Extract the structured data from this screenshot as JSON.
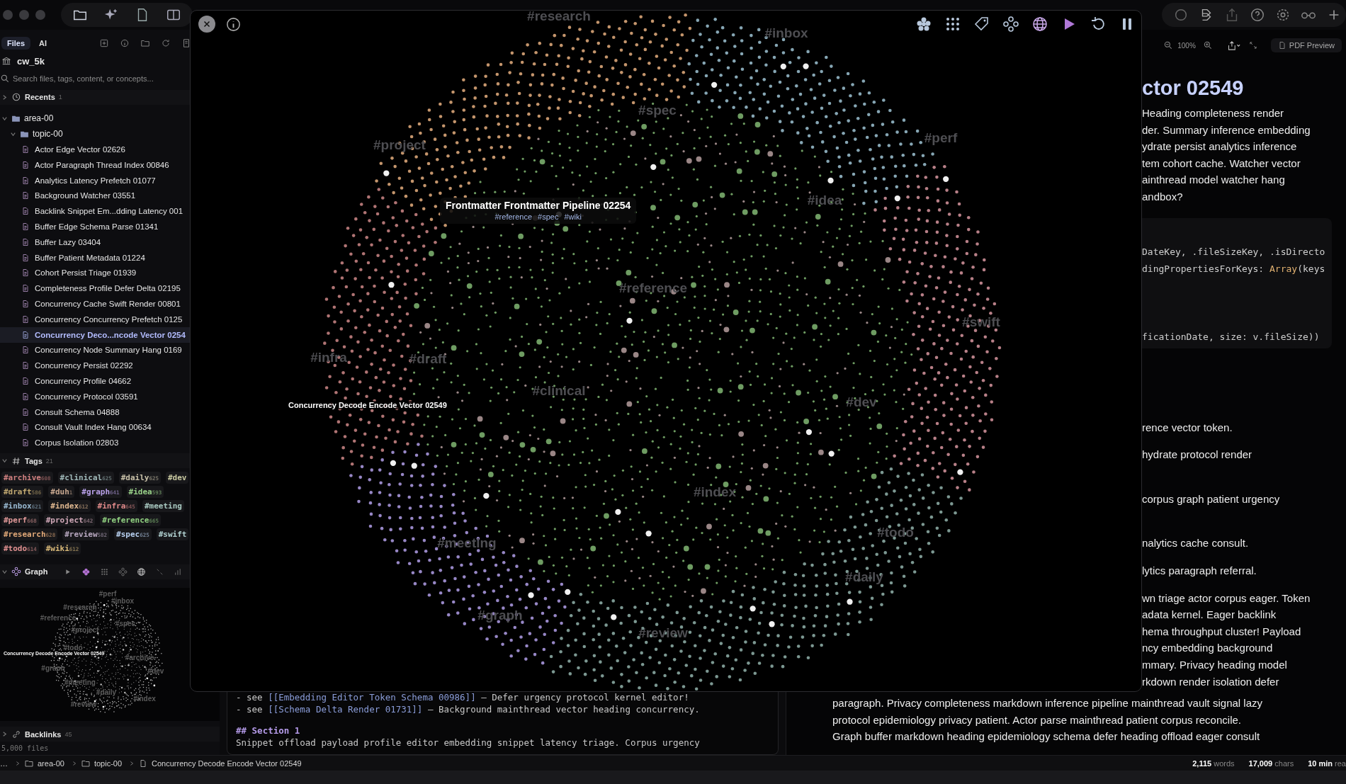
{
  "sidebar": {
    "tabs": [
      {
        "label": "Files",
        "selected": true
      },
      {
        "label": "AI",
        "selected": false
      }
    ],
    "vault": "cw_5k",
    "search": {
      "placeholder": "Search files, tags, content, or concepts..."
    },
    "recents": {
      "label": "Recents",
      "count": "1",
      "expanded": false
    },
    "tree": [
      {
        "label": "area-00",
        "expanded": true,
        "children": [
          {
            "label": "topic-00",
            "expanded": true,
            "children": [
              {
                "label": "Actor Edge Vector 02626",
                "selected": false
              },
              {
                "label": "Actor Paragraph Thread Index 00846",
                "selected": false
              },
              {
                "label": "Analytics Latency Prefetch 01077",
                "selected": false
              },
              {
                "label": "Background Watcher 03551",
                "selected": false
              },
              {
                "label": "Backlink Snippet Em...dding Latency 001",
                "selected": false
              },
              {
                "label": "Buffer Edge Schema Parse 01341",
                "selected": false
              },
              {
                "label": "Buffer Lazy 03404",
                "selected": false
              },
              {
                "label": "Buffer Patient Metadata 01224",
                "selected": false
              },
              {
                "label": "Cohort Persist Triage 01939",
                "selected": false
              },
              {
                "label": "Completeness Profile Defer Delta 02195",
                "selected": false
              },
              {
                "label": "Concurrency Cache Swift Render 00801",
                "selected": false
              },
              {
                "label": "Concurrency Concurrency Prefetch 0125",
                "selected": false
              },
              {
                "label": "Concurrency Deco...ncode Vector 0254",
                "selected": true
              },
              {
                "label": "Concurrency Node Summary Hang 0169",
                "selected": false
              },
              {
                "label": "Concurrency Persist 02292",
                "selected": false
              },
              {
                "label": "Concurrency Profile 04662",
                "selected": false
              },
              {
                "label": "Concurrency Protocol 03591",
                "selected": false
              },
              {
                "label": "Consult Schema 04888",
                "selected": false
              },
              {
                "label": "Consult Vault Index Hang 00634",
                "selected": false
              },
              {
                "label": "Corpus Isolation 02803",
                "selected": false
              }
            ]
          }
        ]
      }
    ],
    "tags": {
      "label": "Tags",
      "count": "21",
      "expanded": true,
      "rows": [
        [
          {
            "name": "#archive",
            "count": "608",
            "color": "#d08080"
          },
          {
            "name": "#clinical",
            "count": "625",
            "color": "#9fb8b8"
          },
          {
            "name": "#daily",
            "count": "625",
            "color": "#c8c0a8"
          },
          {
            "name": "#dev",
            "color": "#c8c8a0"
          }
        ],
        [
          {
            "name": "#draft",
            "count": "586",
            "color": "#c0a870"
          },
          {
            "name": "#duh",
            "count": "1",
            "color": "#c8a890"
          },
          {
            "name": "#graph",
            "count": "641",
            "color": "#b8a0e8"
          },
          {
            "name": "#idea",
            "count": "593",
            "color": "#98d088"
          }
        ],
        [
          {
            "name": "#inbox",
            "count": "621",
            "color": "#98b8d0"
          },
          {
            "name": "#index",
            "count": "612",
            "color": "#e0b890"
          },
          {
            "name": "#infra",
            "count": "645",
            "color": "#e08a8a"
          },
          {
            "name": "#meeting",
            "color": "#a8c8c0"
          }
        ],
        [
          {
            "name": "#perf",
            "count": "668",
            "color": "#e09898"
          },
          {
            "name": "#project",
            "count": "642",
            "color": "#d0a8b8"
          },
          {
            "name": "#reference",
            "count": "665",
            "color": "#90d080"
          }
        ],
        [
          {
            "name": "#research",
            "count": "628",
            "color": "#e0a878"
          },
          {
            "name": "#review",
            "count": "582",
            "color": "#b8a8c0"
          },
          {
            "name": "#spec",
            "count": "625",
            "color": "#b8d0f0"
          },
          {
            "name": "#swift",
            "color": "#b0d0d0"
          }
        ],
        [
          {
            "name": "#todo",
            "count": "614",
            "color": "#e09090"
          },
          {
            "name": "#wiki",
            "count": "612",
            "color": "#d8b878"
          }
        ]
      ]
    },
    "graph": {
      "label": "Graph",
      "expanded": true,
      "labels": [
        "#perf",
        "#inbox",
        "#research",
        "#reference",
        "#project",
        "#spec",
        "#todo",
        "#archive",
        "#graph",
        "#dev",
        "#meeting",
        "#daily",
        "#index",
        "#review"
      ],
      "node_label": "Concurrency Decode Encode Vector 02549"
    },
    "backlinks": {
      "label": "Backlinks",
      "count": "45",
      "expanded": false
    },
    "file_count": "5,000 files"
  },
  "editor": {
    "lines": [
      {
        "kind": "link",
        "prefix": "- see ",
        "link": "[[Embedding Editor Token Schema 00986]]",
        "suffix": " — Defer urgency protocol kernel editor!"
      },
      {
        "kind": "link",
        "prefix": "- see ",
        "link": "[[Schema Delta Render 01731]]",
        "suffix": " — Background mainthread vector heading concurrency."
      },
      {
        "kind": "blank"
      },
      {
        "kind": "heading",
        "text": "## Section 1"
      },
      {
        "kind": "text",
        "text": "Snippet offload payload profile editor embedding snippet latency triage. Corpus urgency"
      }
    ]
  },
  "preview": {
    "zoom": "100%",
    "pdf_button": "PDF Preview",
    "title": "ctor 02549",
    "upper_lines": [
      "Heading completeness render",
      "der. Summary inference embedding",
      "ydrate persist analytics inference",
      "tem cohort cache. Watcher vector",
      "ainthread model watcher hang",
      "andbox?"
    ],
    "code_lines": [
      {
        "kind": "plain",
        "text": "DateKey, .fileSizeKey, .isDirecto"
      },
      {
        "kind": "type",
        "text": "dingPropertiesForKeys: ",
        "type": "Array",
        "rest": "(keys"
      },
      {
        "kind": "gap"
      },
      {
        "kind": "gap"
      },
      {
        "kind": "gap"
      },
      {
        "kind": "plain",
        "text": "ficationDate, size: v.fileSize))"
      }
    ],
    "middle_lines": [
      "rence vector token.",
      "hydrate protocol render",
      "corpus graph patient urgency",
      "nalytics cache consult.",
      "lytics paragraph referral."
    ],
    "paragraph_lines": [
      "wn triage actor corpus eager. Token",
      "adata kernel. Eager backlink",
      "hema throughput cluster! Payload",
      "ncy embedding background",
      "mmary. Privacy heading model",
      "rkdown render isolation defer"
    ],
    "lower_lines": [
      "paragraph. Privacy completeness markdown inference pipeline mainthread vault signal lazy",
      "protocol epidemiology privacy patient. Actor parse mainthread patient corpus reconcile.",
      "Graph buffer markdown heading epidemiology schema defer heading offload eager consult"
    ]
  },
  "graph_view": {
    "tag_labels": [
      "#research",
      "#inbox",
      "#spec",
      "#project",
      "#perf",
      "#idea",
      "#reference",
      "#swift",
      "#infra",
      "#draft",
      "#clinical",
      "#dev",
      "#index",
      "#meeting",
      "#todo",
      "#daily",
      "#graph",
      "#review"
    ],
    "tooltip": {
      "title": "Frontmatter Frontmatter Pipeline 02254",
      "tags": [
        "#reference",
        "#spec",
        "#wiki"
      ]
    },
    "node_label": "Concurrency Decode Encode Vector 02549"
  },
  "status_bar": {
    "breadcrumb": [
      "…",
      "area-00",
      "topic-00",
      "Concurrency Decode Encode Vector 02549"
    ],
    "stats": [
      "**2,115** words",
      "**17,009** chars",
      "**10 min** rea"
    ]
  }
}
